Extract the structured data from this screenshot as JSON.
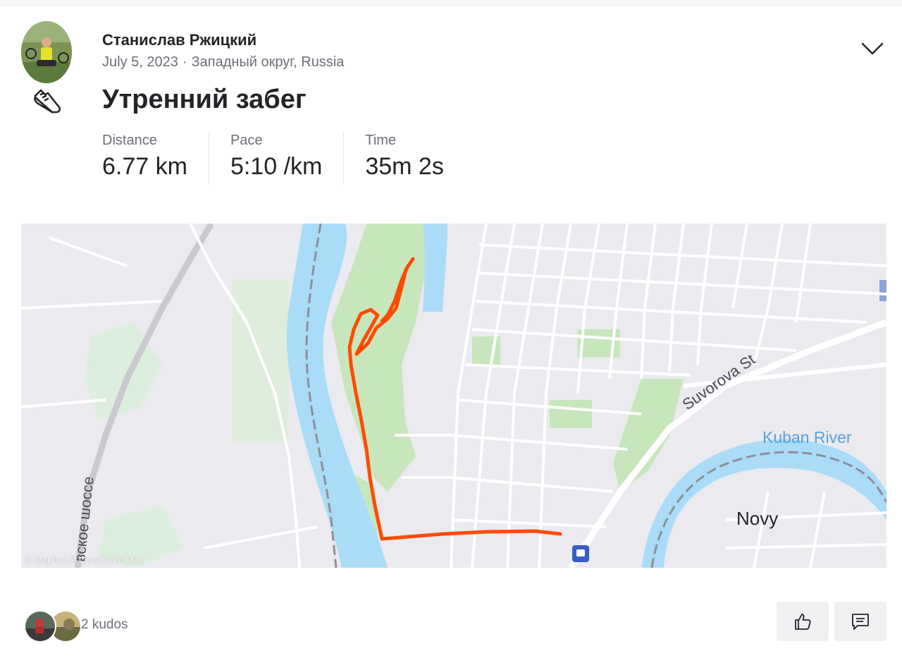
{
  "activity": {
    "athlete_name": "Станислав Ржицкий",
    "date": "July 5, 2023",
    "separator": "·",
    "location": "Западный округ, Russia",
    "sport_icon": "running-shoe-icon",
    "title": "Утренний забег"
  },
  "stats": [
    {
      "label": "Distance",
      "value": "6.77 km"
    },
    {
      "label": "Pace",
      "value": "5:10 /km"
    },
    {
      "label": "Time",
      "value": "35m 2s"
    }
  ],
  "map": {
    "labels": {
      "street": "Suvorova St",
      "river": "Kuban River",
      "district": "Novy",
      "highway": "вское шоссе"
    },
    "attribution": "© Mapbox © OpenStreetMap",
    "route_color": "#fc4c02",
    "water_color": "#aadcf7",
    "park_color": "#c8e6bc"
  },
  "social": {
    "kudos_text": "2 kudos",
    "kudos_count": 2,
    "kudos_button_icon": "thumbs-up-icon",
    "comment_button_icon": "comment-icon"
  },
  "menu_icon": "chevron-down-icon"
}
